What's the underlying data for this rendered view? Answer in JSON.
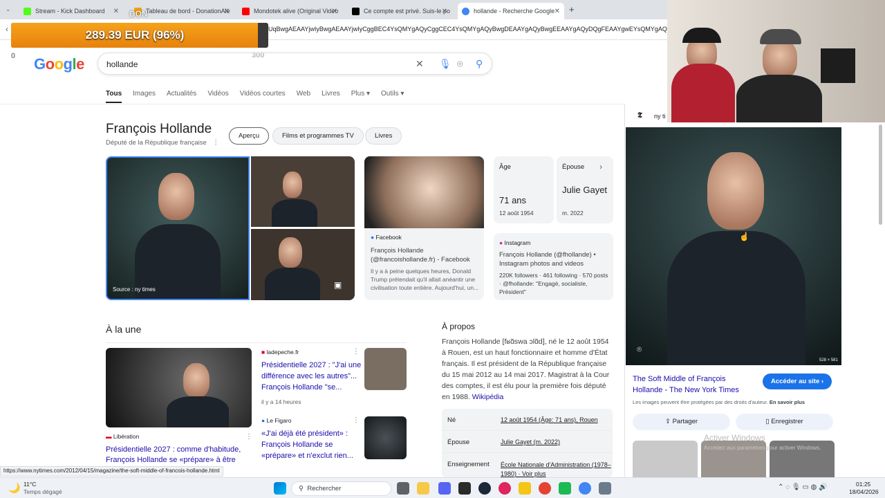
{
  "tabs": [
    {
      "title": "Stream - Kick Dashboard",
      "color": "#53fc18"
    },
    {
      "title": "Tableau de bord - DonationAle",
      "color": "#f59e0b"
    },
    {
      "title": "Mondotek alive (Original Video",
      "color": "#ff0000"
    },
    {
      "title": "Ce compte est privé. Suis-le po",
      "color": "#000000"
    },
    {
      "title": "hollande - Recherche Google",
      "color": "#4285f4"
    }
  ],
  "url": "UqBwgAEAAYjwIyBwgAEAAYjwIyCggBEC4YsQMYgAQyCggCEC4YsQMYgAQyBwgDEAAYgAQyBwgEEAAYgAQyDQgFEAAYgwEYsQMYgAQyBwgGEAAYgAQy",
  "donation": {
    "text": "289.39 EUR (96%)",
    "progress": 0.96,
    "tag": "DON",
    "min": "0",
    "max": "300"
  },
  "search": {
    "query": "hollande",
    "logo": "Google"
  },
  "nav": [
    "Tous",
    "Images",
    "Actualités",
    "Vidéos",
    "Vidéos courtes",
    "Web",
    "Livres",
    "Plus ▾",
    "Outils ▾"
  ],
  "kp": {
    "name": "François Hollande",
    "subtitle": "Député de la République française",
    "pills": [
      "Aperçu",
      "Films et programmes TV",
      "Livres"
    ],
    "source": "Source : ny times",
    "facebook": {
      "tag": "Facebook",
      "title": "François Hollande (@francoishollande.fr) - Facebook",
      "snippet": "Il y a à peine quelques heures, Donald Trump prétendait qu'il allait anéantir une civilisation toute entière. Aujourd'hui, un..."
    },
    "age": {
      "label": "Âge",
      "value": "71 ans",
      "sub": "12 août 1954"
    },
    "spouse": {
      "label": "Épouse",
      "value": "Julie Gayet",
      "sub": "m. 2022"
    },
    "instagram": {
      "tag": "Instagram",
      "title": "François Hollande (@fhollande) • Instagram photos and videos",
      "snippet": "220K followers · 461 following · 570 posts · @fhollande: \"Engagé, socialiste, Président\""
    }
  },
  "news": {
    "heading": "À la une",
    "items": [
      {
        "source": "ladepeche.fr",
        "title": "Présidentielle 2027 : \"J'ai une différence avec les autres\"... François Hollande \"se...",
        "time": "il y a 14 heures"
      },
      {
        "source": "Le Figaro",
        "title": "«J'ai déjà été président» : François Hollande se «prépare» et n'exclut rien..."
      },
      {
        "source": "Libération",
        "title": "Présidentielle 2027 : comme d'habitude, François Hollande se «prépare» à être"
      }
    ]
  },
  "about": {
    "heading": "À propos",
    "text": "François Hollande [fʁɑ̃swa ɔlɑ̃d], né le 12 août 1954 à Rouen, est un haut fonctionnaire et homme d'État français. Il est président de la République française du 15 mai 2012 au 14 mai 2017. Magistrat à la Cour des comptes, il est élu pour la première fois député en 1988.",
    "link": "Wikipédia",
    "facts": [
      {
        "k": "Né",
        "v": "12 août 1954 (Âge: 71 ans), Rouen"
      },
      {
        "k": "Épouse",
        "v": "Julie Gayet (m. 2022)"
      },
      {
        "k": "Enseignement",
        "v": "École Nationale d'Administration (1978–1980) · Voir plus"
      }
    ]
  },
  "viewer": {
    "site": "ny ti",
    "dims": "528 × 581",
    "title": "The Soft Middle of François Hollande - The New York Times",
    "visit": "Accéder au site ›",
    "rights": "Les images peuvent être protégées par des droits d'auteur.",
    "more": "En savoir plus",
    "share": "Partager",
    "save": "Enregistrer",
    "watermark1": "Activer Windows",
    "watermark2": "Accédez aux paramètres pour activer Windows."
  },
  "status_url": "https://www.nytimes.com/2012/04/15/magazine/the-soft-middle-of-francois-hollande.html",
  "taskbar": {
    "temp": "11°C",
    "weather": "Temps dégagé",
    "search": "Rechercher",
    "time": "01:25",
    "date": "18/04/2026"
  }
}
